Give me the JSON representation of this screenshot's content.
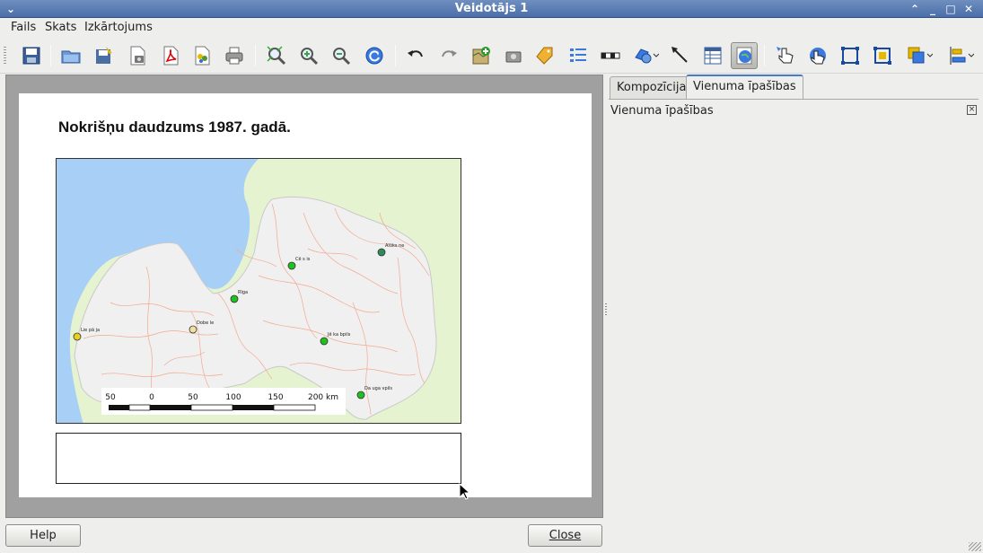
{
  "window": {
    "title": "Veidotājs 1",
    "menu_icon": "chevron-down-icon",
    "controls": [
      "chevron-up-icon",
      "minimize-icon",
      "maximize-icon",
      "close-icon"
    ]
  },
  "menu": {
    "items": [
      "Fails",
      "Skats",
      "Izkārtojums"
    ]
  },
  "toolbar": {
    "icons": [
      "save-icon",
      "open-icon",
      "save-as-template-icon",
      "export-image-icon",
      "export-pdf-icon",
      "export-svg-icon",
      "print-icon",
      "zoom-full-icon",
      "zoom-in-icon",
      "zoom-out-icon",
      "refresh-icon",
      "undo-icon",
      "redo-icon",
      "add-map-icon",
      "add-image-icon",
      "add-label-icon",
      "add-legend-icon",
      "add-scalebar-icon",
      "add-shape-icon",
      "add-arrow-icon",
      "add-table-icon",
      "add-html-icon",
      "select-move-icon",
      "move-content-icon",
      "group-icon",
      "ungroup-icon",
      "raise-icon",
      "align-icon"
    ],
    "active": "add-html-icon"
  },
  "composition": {
    "map_title": "Nokrišņu daudzums 1987. gadā.",
    "scalebar": {
      "labels": [
        "50",
        "0",
        "50",
        "100",
        "150",
        "200 km"
      ]
    },
    "stations": [
      {
        "name": "Liepāja",
        "label": "Lie pā ja",
        "color": "#e8d020"
      },
      {
        "name": "Dobele",
        "label": "Dobe le",
        "color": "#f0e0a0"
      },
      {
        "name": "Rīga",
        "label": "Rīga",
        "color": "#20c020"
      },
      {
        "name": "Cēsis",
        "label": "Cē s is",
        "color": "#20c020"
      },
      {
        "name": "Alūksne",
        "label": "Alūks ne",
        "color": "#2e8b57"
      },
      {
        "name": "Jēkabpils",
        "label": "Jē ka bpils",
        "color": "#20c020"
      },
      {
        "name": "Daugavpils",
        "label": "Da uga vpils",
        "color": "#20c020"
      }
    ],
    "colors": {
      "sea": "#a8cff5",
      "land": "#f0f0f0",
      "neighbor": "#e6f3d0",
      "borders": "#f4a890"
    }
  },
  "panel": {
    "tabs": [
      "Kompozīcija",
      "Vienuma īpašības"
    ],
    "active_tab": "Vienuma īpašības",
    "dock_title": "Vienuma īpašības",
    "dock_close": "×"
  },
  "buttons": {
    "help": "Help",
    "close": "Close"
  }
}
